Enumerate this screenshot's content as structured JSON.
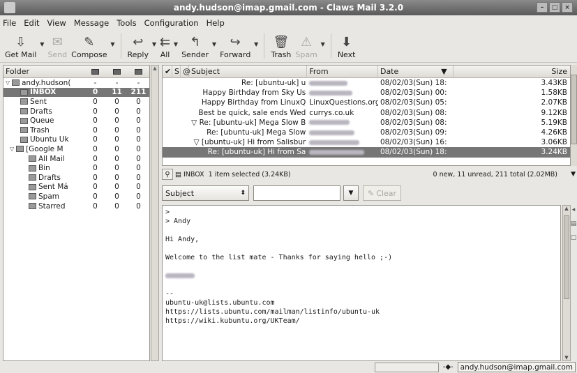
{
  "window": {
    "title": "andy.hudson@imap.gmail.com - Claws Mail 3.2.0"
  },
  "menu": [
    "File",
    "Edit",
    "View",
    "Message",
    "Tools",
    "Configuration",
    "Help"
  ],
  "toolbar": [
    {
      "label": "Get Mail",
      "icon": "get-mail-icon",
      "glyph": "⇩",
      "enabled": true,
      "dropdown": true
    },
    {
      "label": "Send",
      "icon": "send-icon",
      "glyph": "✉",
      "enabled": false,
      "dropdown": false
    },
    {
      "label": "Compose",
      "icon": "compose-icon",
      "glyph": "✎",
      "enabled": true,
      "dropdown": true
    },
    {
      "label": "Reply",
      "icon": "reply-icon",
      "glyph": "↩",
      "enabled": true,
      "dropdown": true
    },
    {
      "label": "All",
      "icon": "reply-all-icon",
      "glyph": "⇇",
      "enabled": true,
      "dropdown": true
    },
    {
      "label": "Sender",
      "icon": "reply-sender-icon",
      "glyph": "↰",
      "enabled": true,
      "dropdown": true
    },
    {
      "label": "Forward",
      "icon": "forward-icon",
      "glyph": "↪",
      "enabled": true,
      "dropdown": true
    },
    {
      "label": "Trash",
      "icon": "trash-icon",
      "glyph": "🗑",
      "enabled": true,
      "dropdown": false
    },
    {
      "label": "Spam",
      "icon": "spam-icon",
      "glyph": "⚠",
      "enabled": false,
      "dropdown": true
    },
    {
      "label": "Next",
      "icon": "next-icon",
      "glyph": "⬇",
      "enabled": true,
      "dropdown": false
    }
  ],
  "folders": {
    "header": "Folder",
    "rows": [
      {
        "name": "andy.hudson(",
        "tri": "▽",
        "indent": 0,
        "new": "-",
        "unread": "-",
        "total": "-",
        "selected": false
      },
      {
        "name": "INBOX",
        "tri": "",
        "indent": 2,
        "new": "0",
        "unread": "11",
        "total": "211",
        "selected": true
      },
      {
        "name": "Sent",
        "tri": "",
        "indent": 2,
        "new": "0",
        "unread": "0",
        "total": "0",
        "selected": false
      },
      {
        "name": "Drafts",
        "tri": "",
        "indent": 2,
        "new": "0",
        "unread": "0",
        "total": "0",
        "selected": false
      },
      {
        "name": "Queue",
        "tri": "",
        "indent": 2,
        "new": "0",
        "unread": "0",
        "total": "0",
        "selected": false
      },
      {
        "name": "Trash",
        "tri": "",
        "indent": 2,
        "new": "0",
        "unread": "0",
        "total": "0",
        "selected": false
      },
      {
        "name": "Ubuntu Uk",
        "tri": "",
        "indent": 2,
        "new": "0",
        "unread": "0",
        "total": "0",
        "selected": false
      },
      {
        "name": "[Google M",
        "tri": "▽",
        "indent": 1,
        "new": "0",
        "unread": "0",
        "total": "0",
        "selected": false
      },
      {
        "name": "All Mail",
        "tri": "",
        "indent": 4,
        "new": "0",
        "unread": "0",
        "total": "0",
        "selected": false
      },
      {
        "name": "Bin",
        "tri": "",
        "indent": 4,
        "new": "0",
        "unread": "0",
        "total": "0",
        "selected": false
      },
      {
        "name": "Drafts",
        "tri": "",
        "indent": 4,
        "new": "0",
        "unread": "0",
        "total": "0",
        "selected": false
      },
      {
        "name": "Sent Má",
        "tri": "",
        "indent": 4,
        "new": "0",
        "unread": "0",
        "total": "0",
        "selected": false
      },
      {
        "name": "Spam",
        "tri": "",
        "indent": 4,
        "new": "0",
        "unread": "0",
        "total": "0",
        "selected": false
      },
      {
        "name": "Starred",
        "tri": "",
        "indent": 4,
        "new": "0",
        "unread": "0",
        "total": "0",
        "selected": false
      }
    ]
  },
  "messages": {
    "columns": {
      "check": "✔",
      "status": "S",
      "attach": "@",
      "subject": "Subject",
      "from": "From",
      "date": "Date",
      "size": "Size"
    },
    "rows": [
      {
        "subject": "Re: [ubuntu-uk] u",
        "from": "",
        "from_blur": true,
        "date": "08/02/03(Sun) 18:",
        "size": "3.43KB",
        "selected": false
      },
      {
        "subject": "Happy Birthday from Sky Us",
        "from": "",
        "from_blur": true,
        "date": "08/02/03(Sun) 00:",
        "size": "1.58KB",
        "selected": false
      },
      {
        "subject": "Happy Birthday from LinuxQ",
        "from": "LinuxQuestions.org",
        "from_blur": false,
        "date": "08/02/03(Sun) 05:",
        "size": "2.07KB",
        "selected": false
      },
      {
        "subject": "Best be quick, sale ends Wed",
        "from": "currys.co.uk",
        "from_blur": false,
        "date": "08/02/03(Sun) 08:",
        "size": "9.12KB",
        "selected": false
      },
      {
        "subject": "▽ Re: [ubuntu-uk] Mega Slow B",
        "from": "",
        "from_blur": true,
        "date": "08/02/03(Sun) 08:",
        "size": "5.19KB",
        "selected": false
      },
      {
        "subject": "Re: [ubuntu-uk] Mega Slow",
        "from": "",
        "from_blur": true,
        "date": "08/02/03(Sun) 09:",
        "size": "4.26KB",
        "selected": false
      },
      {
        "subject": "▽ [ubuntu-uk] Hi from Salisbur",
        "from": "",
        "from_blur": true,
        "date": "08/02/03(Sun) 16:",
        "size": "3.06KB",
        "selected": false
      },
      {
        "subject": "Re: [ubuntu-uk] Hi from Sa",
        "from": "",
        "from_blur": true,
        "date": "08/02/03(Sun) 18:",
        "size": "3.24KB",
        "selected": true
      }
    ]
  },
  "strip": {
    "folder": "INBOX",
    "selection": "1 item selected (3.24KB)",
    "summary": "0 new, 11 unread, 211 total (2.02MB)"
  },
  "search": {
    "field": "Subject",
    "value": "",
    "clear_label": "Clear"
  },
  "body_lines": [
    ">",
    "> Andy",
    "",
    "Hi Andy,",
    "",
    "Welcome to the list mate - Thanks for saying hello ;-)",
    "",
    "",
    "",
    "--",
    "ubuntu-uk@lists.ubuntu.com",
    "https://lists.ubuntu.com/mailman/listinfo/ubuntu-uk",
    "https://wiki.kubuntu.org/UKTeam/"
  ],
  "statusbar": {
    "account": "andy.hudson@imap.gmail.com"
  },
  "colors": {
    "selection": "#767676",
    "chrome": "#e9e7e3",
    "titlebar": "#6a6a6a"
  }
}
